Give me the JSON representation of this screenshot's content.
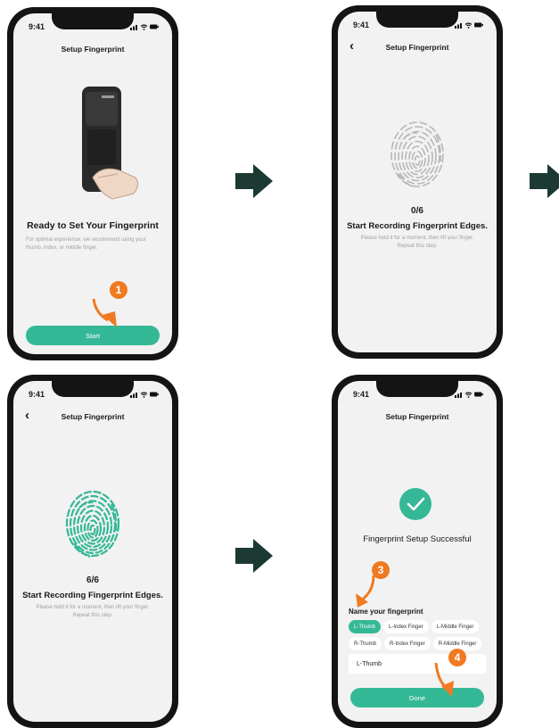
{
  "status_time": "9:41",
  "screens": [
    {
      "title": "Setup Fingerprint",
      "heading": "Ready to Set Your Fingerprint",
      "description": "For optimal experience, we recommend using your thumb, index, or middle finger.",
      "button_label": "Start",
      "step": "1"
    },
    {
      "title": "Setup Fingerprint",
      "progress_text": "0/6",
      "progress": 0,
      "heading": "Start Recording Fingerprint Edges.",
      "description": "Please hold it for a moment, then lift your finger. Repeat this step."
    },
    {
      "title": "Setup Fingerprint",
      "progress_text": "6/6",
      "progress": 1,
      "heading": "Start Recording Fingerprint Edges.",
      "description": "Please hold it for a moment, then lift your finger. Repeat this step."
    },
    {
      "title": "Setup Fingerprint",
      "heading": "Fingerprint Setup Successful",
      "name_label": "Name your fingerprint",
      "chips": [
        "L-Thumb",
        "L-Index Finger",
        "L-Middle Finger",
        "R-Thumb",
        "R-Index Finger",
        "R-Middle Finger"
      ],
      "selected_chip": "L-Thumb",
      "input_value": "L-Thumb",
      "button_label": "Done",
      "steps": [
        "3",
        "4"
      ]
    }
  ],
  "colors": {
    "accent": "#35b896",
    "annotation": "#f07a22",
    "flow_arrow": "#1c3a33"
  },
  "icons": [
    "back-chevron-icon",
    "signal-icon",
    "wifi-icon",
    "battery-icon",
    "fingerprint-icon",
    "checkmark-icon",
    "flow-arrow-icon"
  ]
}
